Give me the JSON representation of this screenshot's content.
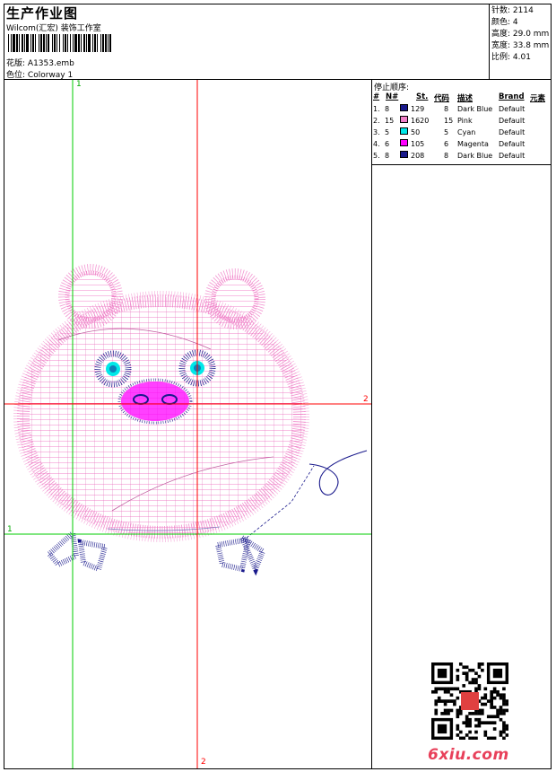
{
  "header": {
    "title": "生产作业图",
    "company": "Wilcom(汇宏) 装饰工作室",
    "file_label": "花版:",
    "file_name": "A1353.emb",
    "colorway_label": "色位:",
    "colorway": "Colorway 1"
  },
  "stats": {
    "stitches": "针数: 2114",
    "colors": "颜色: 4",
    "height": "高度: 29.0 mm",
    "width": "宽度: 33.8 mm",
    "scale": "比例: 4.01"
  },
  "guides": {
    "v1_top": "1",
    "h2_right": "2",
    "h1_left": "1",
    "v2_bottom": "2"
  },
  "stop_sequence": {
    "title": "停止顺序:",
    "headers": [
      "#",
      "N#",
      "St.",
      "代码",
      "描述",
      "Brand",
      "元素"
    ],
    "rows": [
      {
        "idx": "1.",
        "n": "8",
        "color": "#1a1a8c",
        "st": "129",
        "code": "8",
        "desc": "Dark Blue",
        "brand": "Default"
      },
      {
        "idx": "2.",
        "n": "15",
        "color": "#f080c8",
        "st": "1620",
        "code": "15",
        "desc": "Pink",
        "brand": "Default"
      },
      {
        "idx": "3.",
        "n": "5",
        "color": "#00e8e8",
        "st": "50",
        "code": "5",
        "desc": "Cyan",
        "brand": "Default"
      },
      {
        "idx": "4.",
        "n": "6",
        "color": "#ff00ff",
        "st": "105",
        "code": "6",
        "desc": "Magenta",
        "brand": "Default"
      },
      {
        "idx": "5.",
        "n": "8",
        "color": "#1a1a8c",
        "st": "208",
        "code": "8",
        "desc": "Dark Blue",
        "brand": "Default"
      }
    ]
  },
  "watermark": "6xiu.com",
  "colors": {
    "guide_green": "#00cc00",
    "guide_red": "#ff0000",
    "pink": "#f080c8",
    "navy": "#1a1a8c"
  }
}
